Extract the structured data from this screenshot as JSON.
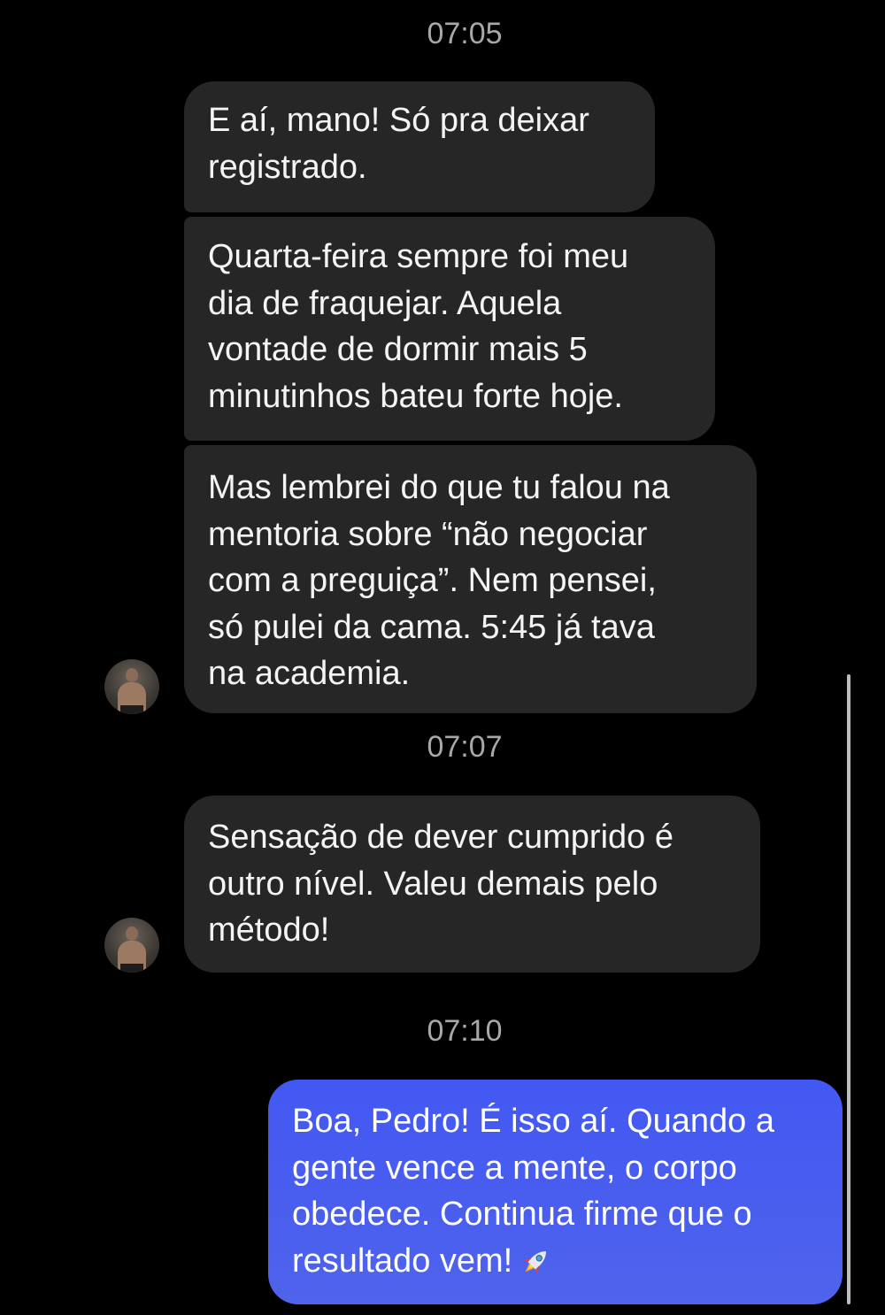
{
  "messages": {
    "time_1": "07:05",
    "msg_1": [
      "E aí, mano! Só pra deixar",
      "registrado."
    ],
    "msg_2": [
      "Quarta-feira sempre foi meu",
      "dia de fraquejar. Aquela",
      "vontade de dormir mais 5",
      "minutinhos bateu forte hoje."
    ],
    "msg_3": [
      "Mas lembrei do que tu falou na",
      "mentoria sobre “não negociar",
      "com a preguiça”. Nem pensei,",
      "só pulei da cama. 5:45 já tava",
      "na academia."
    ],
    "time_2": "07:07",
    "msg_4": [
      "Sensação de dever cumprido é",
      "outro nível. Valeu demais pelo",
      "método!"
    ],
    "time_3": "07:10",
    "msg_5": [
      "Boa, Pedro! É isso aí. Quando a",
      "gente vence a mente, o corpo",
      "obedece. Continua firme que o",
      "resultado vem!"
    ],
    "msg_5_emoji": "rocket-icon"
  },
  "colors": {
    "background": "#000000",
    "incoming_bubble": "#262626",
    "outgoing_bubble": "#4c5dea",
    "timestamp_text": "#a8a8a8"
  }
}
